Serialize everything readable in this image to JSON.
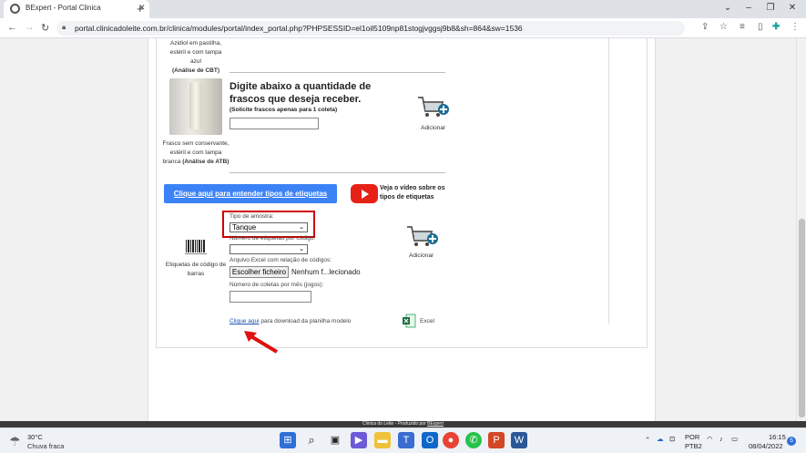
{
  "browser": {
    "tab_title": "BExpert - Portal Clinica",
    "url": "portal.clinicadoleite.com.br/clinica/modules/portal/index_portal.php?PHPSESSID=el1oil5109np81stogjvggsj9b8&sh=864&sw=1536"
  },
  "page": {
    "azidiol_caption": [
      "Azidiol em pastilha,",
      "estéril e com tampa azul"
    ],
    "azidiol_bold": "(Análise de CBT)",
    "frasco_heading": "Digite abaixo a quantidade de frascos que deseja receber.",
    "frasco_subnote": "(Solicite frascos apenas para 1 coleta)",
    "frasco_caption": [
      "Frasco sem conservante,",
      "estéril e com tampa"
    ],
    "frasco_caption_last": "branca",
    "frasco_bold": "(Análise de ATB)",
    "add_label_1": "Adicionar",
    "add_label_2": "Adicionar",
    "etiquetas_button": "Clique aqui para entender tipos de etiquetas",
    "video_text": [
      "Veja o vídeo sobre os",
      "tipos de etiquetas"
    ],
    "barcode_caption": [
      "Etiquetas de código de",
      "barras"
    ],
    "tipo_amostra_label": "Tipo de amostra:",
    "tipo_amostra_value": "Tanque",
    "num_etiquetas_label": "Número de etiquetas por código:",
    "num_etiquetas_value": "",
    "arquivo_label": "Arquivo Excel com relação de códigos:",
    "file_button": "Escolher ficheiro",
    "file_status": "Nenhum f...lecionado",
    "num_coletas_label": "Número de coletas por mês (jogos):",
    "download_link": "Clique aqui",
    "download_rest": " para download da planilha modelo",
    "excel_label": "Excel"
  },
  "footer": {
    "text": "Clinica do Leite - Produzido por",
    "link": "BExpert"
  },
  "taskbar": {
    "temp": "30°C",
    "weather": "Chuva fraca",
    "lang1": "POR",
    "lang2": "PTB2",
    "time": "16:15",
    "date": "08/04/2022",
    "notif": "5"
  },
  "colors": {
    "accent_button": "#3b82f6",
    "highlight_box": "#d20000",
    "youtube": "#e62117"
  }
}
